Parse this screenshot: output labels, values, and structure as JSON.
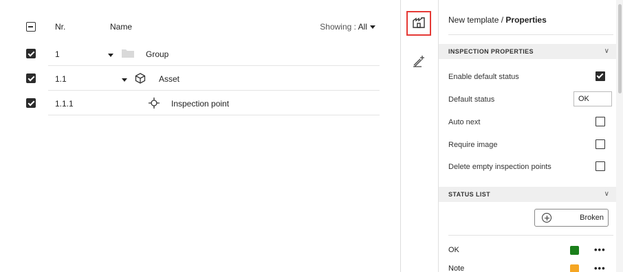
{
  "tree": {
    "header": {
      "nr_label": "Nr.",
      "name_label": "Name",
      "showing_label": "Showing :",
      "showing_value": "All"
    },
    "rows": [
      {
        "nr": "1",
        "name": "Group",
        "icon": "folder-icon",
        "checked": true
      },
      {
        "nr": "1.1",
        "name": "Asset",
        "icon": "cube-icon",
        "checked": true
      },
      {
        "nr": "1.1.1",
        "name": "Inspection point",
        "icon": "crosshair-icon",
        "checked": true
      }
    ]
  },
  "rail": {
    "tools": [
      {
        "icon": "template-properties-icon",
        "active": true
      },
      {
        "icon": "add-inspection-icon",
        "active": false
      }
    ]
  },
  "panel": {
    "breadcrumb_parent": "New template",
    "breadcrumb_separator": "/",
    "breadcrumb_current": "Properties",
    "inspection_section": {
      "title": "INSPECTION PROPERTIES",
      "enable_default_status": {
        "label": "Enable default status",
        "checked": true
      },
      "default_status": {
        "label": "Default status",
        "value": "OK"
      },
      "auto_next": {
        "label": "Auto next",
        "checked": false
      },
      "require_image": {
        "label": "Require image",
        "checked": false
      },
      "delete_empty": {
        "label": "Delete empty inspection points",
        "checked": false
      }
    },
    "status_section": {
      "title": "STATUS LIST",
      "add_button_label": "Broken",
      "statuses": [
        {
          "label": "OK",
          "color": "#1a7f1a"
        },
        {
          "label": "Note",
          "color": "#f5a623"
        }
      ],
      "more_label": "•••"
    }
  }
}
